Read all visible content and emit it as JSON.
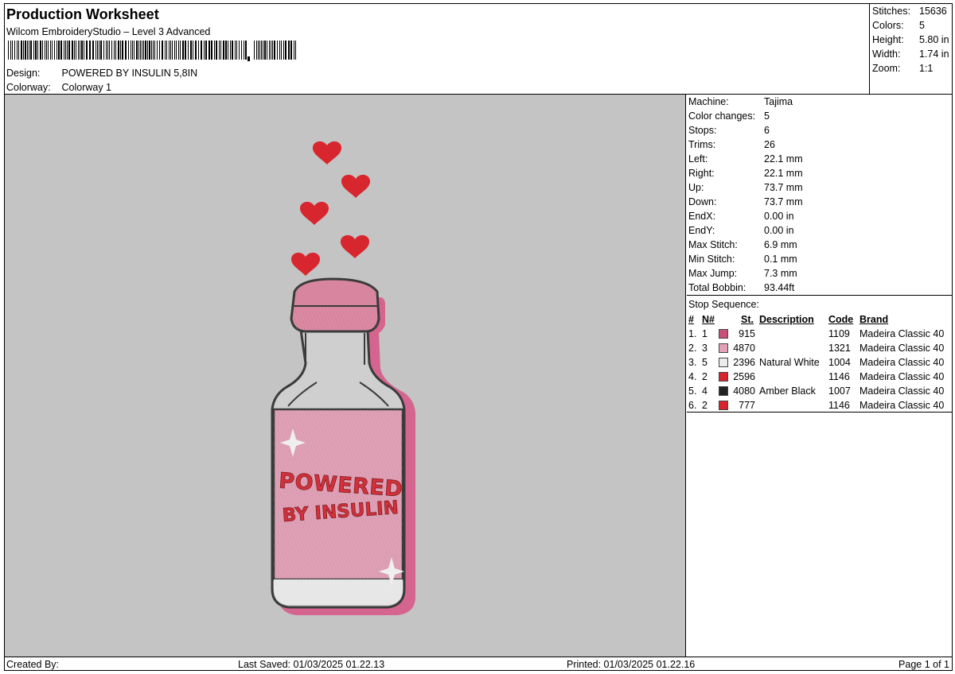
{
  "header": {
    "title": "Production Worksheet",
    "subtitle": "Wilcom EmbroideryStudio – Level 3 Advanced",
    "design_label": "Design:",
    "design_value": "POWERED BY INSULIN 5,8IN",
    "colorway_label": "Colorway:",
    "colorway_value": "Colorway 1"
  },
  "stats": [
    {
      "label": "Stitches:",
      "value": "15636"
    },
    {
      "label": "Colors:",
      "value": "5"
    },
    {
      "label": "Height:",
      "value": "5.80 in"
    },
    {
      "label": "Width:",
      "value": "1.74 in"
    },
    {
      "label": "Zoom:",
      "value": "1:1"
    }
  ],
  "machine": [
    {
      "label": "Machine:",
      "value": "Tajima"
    },
    {
      "label": "Color changes:",
      "value": "5"
    },
    {
      "label": "Stops:",
      "value": "6"
    },
    {
      "label": "Trims:",
      "value": "26"
    },
    {
      "label": "Left:",
      "value": "22.1 mm"
    },
    {
      "label": "Right:",
      "value": "22.1 mm"
    },
    {
      "label": "Up:",
      "value": "73.7 mm"
    },
    {
      "label": "Down:",
      "value": "73.7 mm"
    },
    {
      "label": "EndX:",
      "value": "0.00 in"
    },
    {
      "label": "EndY:",
      "value": "0.00 in"
    },
    {
      "label": "Max Stitch:",
      "value": "6.9 mm"
    },
    {
      "label": "Min Stitch:",
      "value": "0.1 mm"
    },
    {
      "label": "Max Jump:",
      "value": "7.3 mm"
    },
    {
      "label": "Total Bobbin:",
      "value": "93.44ft"
    }
  ],
  "stop_sequence": {
    "title": "Stop Sequence:",
    "headers": {
      "num": "#",
      "n": "N#",
      "st": "St.",
      "desc": "Description",
      "code": "Code",
      "brand": "Brand"
    },
    "rows": [
      {
        "num": "1.",
        "n": "1",
        "color": "#c9507a",
        "st": "915",
        "desc": "",
        "code": "1109",
        "brand": "Madeira Classic 40"
      },
      {
        "num": "2.",
        "n": "3",
        "color": "#e3a1b8",
        "st": "4870",
        "desc": "",
        "code": "1321",
        "brand": "Madeira Classic 40"
      },
      {
        "num": "3.",
        "n": "5",
        "color": "#ececec",
        "st": "2396",
        "desc": "Natural White",
        "code": "1004",
        "brand": "Madeira Classic 40"
      },
      {
        "num": "4.",
        "n": "2",
        "color": "#d6252d",
        "st": "2596",
        "desc": "",
        "code": "1146",
        "brand": "Madeira Classic 40"
      },
      {
        "num": "5.",
        "n": "4",
        "color": "#222222",
        "st": "4080",
        "desc": "Amber Black",
        "code": "1007",
        "brand": "Madeira Classic 40"
      },
      {
        "num": "6.",
        "n": "2",
        "color": "#d6252d",
        "st": "777",
        "desc": "",
        "code": "1146",
        "brand": "Madeira Classic 40"
      }
    ]
  },
  "design_text": {
    "line1": "POWERED",
    "line2": "BY INSULIN"
  },
  "footer": {
    "created_by": "Created By:",
    "last_saved": "Last Saved: 01/03/2025 01.22.13",
    "printed": "Printed: 01/03/2025 01.22.16",
    "page": "Page 1 of 1"
  }
}
